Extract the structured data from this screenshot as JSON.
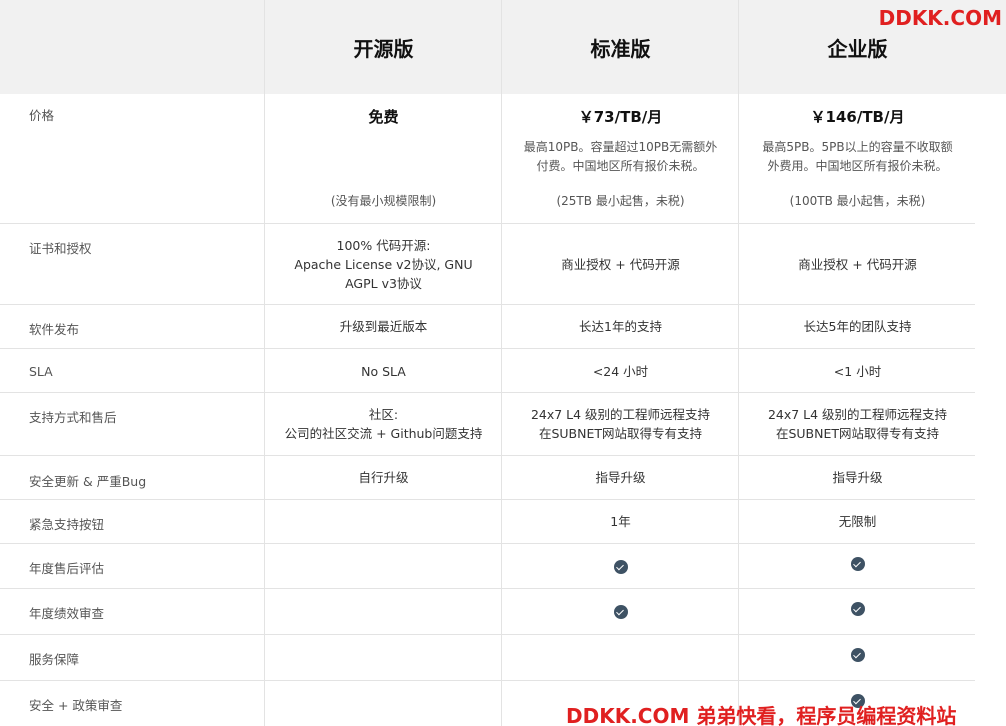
{
  "watermark_top": "DDKK.COM",
  "watermark_bottom": "DDKK.COM 弟弟快看，程序员编程资料站",
  "plans": {
    "open": "开源版",
    "standard": "标准版",
    "enterprise": "企业版"
  },
  "rows": {
    "price": {
      "label": "价格",
      "open": "免费",
      "open_note": "(没有最小规模限制)",
      "standard": "￥73/TB/月",
      "standard_desc_1": "最高10PB。容量超过10PB无需额外",
      "standard_desc_2": "付费。中国地区所有报价未税。",
      "standard_note": "(25TB 最小起售，未税)",
      "enterprise": "￥146/TB/月",
      "enterprise_desc_1": "最高5PB。5PB以上的容量不收取额",
      "enterprise_desc_2": "外费用。中国地区所有报价未税。",
      "enterprise_note": "(100TB 最小起售，未税)"
    },
    "license": {
      "label": "证书和授权",
      "open_1": "100% 代码开源:",
      "open_2": "Apache License v2协议, GNU",
      "open_3": "AGPL v3协议",
      "standard": "商业授权 + 代码开源",
      "enterprise": "商业授权 + 代码开源"
    },
    "release": {
      "label": "软件发布",
      "open": "升级到最近版本",
      "standard": "长达1年的支持",
      "enterprise": "长达5年的团队支持"
    },
    "sla": {
      "label": "SLA",
      "open": "No SLA",
      "standard": "<24 小时",
      "enterprise": "<1 小时"
    },
    "support": {
      "label": "支持方式和售后",
      "open_1": "社区:",
      "open_2": "公司的社区交流 + Github问题支持",
      "standard_1": "24x7 L4 级别的工程师远程支持",
      "standard_2": "在SUBNET网站取得专有支持",
      "enterprise_1": "24x7 L4 级别的工程师远程支持",
      "enterprise_2": "在SUBNET网站取得专有支持"
    },
    "security": {
      "label": "安全更新 & 严重Bug",
      "open": "自行升级",
      "standard": "指导升级",
      "enterprise": "指导升级"
    },
    "emergency": {
      "label": "紧急支持按钮",
      "standard": "1年",
      "enterprise": "无限制"
    },
    "annual_review": {
      "label": "年度售后评估"
    },
    "performance": {
      "label": "年度绩效审查"
    },
    "guarantee": {
      "label": "服务保障"
    },
    "policy": {
      "label": "安全 + 政策审查"
    }
  },
  "check_icon": "check-circle-icon",
  "colors": {
    "header_bg": "#f1f1f1",
    "check": "#3e5264",
    "watermark": "#e02020"
  }
}
